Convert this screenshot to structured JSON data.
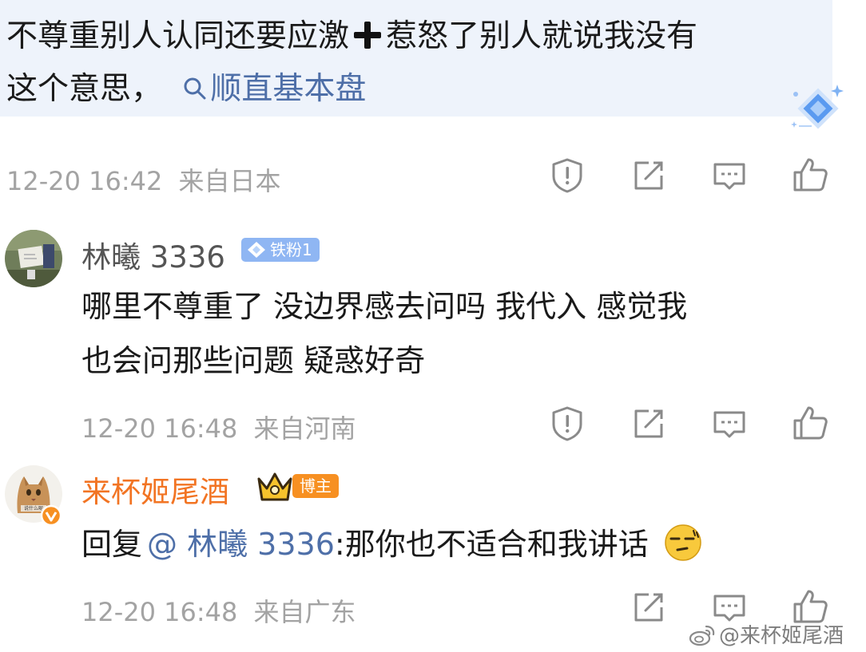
{
  "parent_comment": {
    "line1_a": "不尊重别人认同还要应激",
    "line1_b": "惹怒了别人就说我没有",
    "line2_text": "这个意思，",
    "topic_link": "顺直基本盘",
    "timestamp": "12-20 16:42",
    "location": "来自日本"
  },
  "reply1": {
    "username": "林曦 3336",
    "fan_badge": "铁粉1",
    "line1": "哪里不尊重了  没边界感去问吗  我代入  感觉我",
    "line2": "也会问那些问题  疑惑好奇",
    "timestamp": "12-20 16:48",
    "location": "来自河南"
  },
  "reply2": {
    "username": "来杯姬尾酒",
    "host_badge": "博主",
    "reply_prefix": "回复",
    "mention": "@ 林曦 3336",
    "text": ":那你也不适合和我讲话",
    "avatar_caption": "说什么呢",
    "timestamp": "12-20 16:48",
    "location": "来自广东"
  },
  "watermark": "@来杯姬尾酒",
  "icons": {
    "report": "report-icon",
    "repost": "repost-icon",
    "comment": "comment-icon",
    "like": "like-icon",
    "search": "search-icon",
    "emoji": "smirk-emoji-icon",
    "verified": "verified-v-icon",
    "crown": "crown-icon",
    "diamond": "diamond-icon"
  },
  "colors": {
    "link": "#4e6fa8",
    "host_name": "#f27423",
    "bubble_bg": "#eef3fb",
    "meta_gray": "#a3a3a3"
  }
}
